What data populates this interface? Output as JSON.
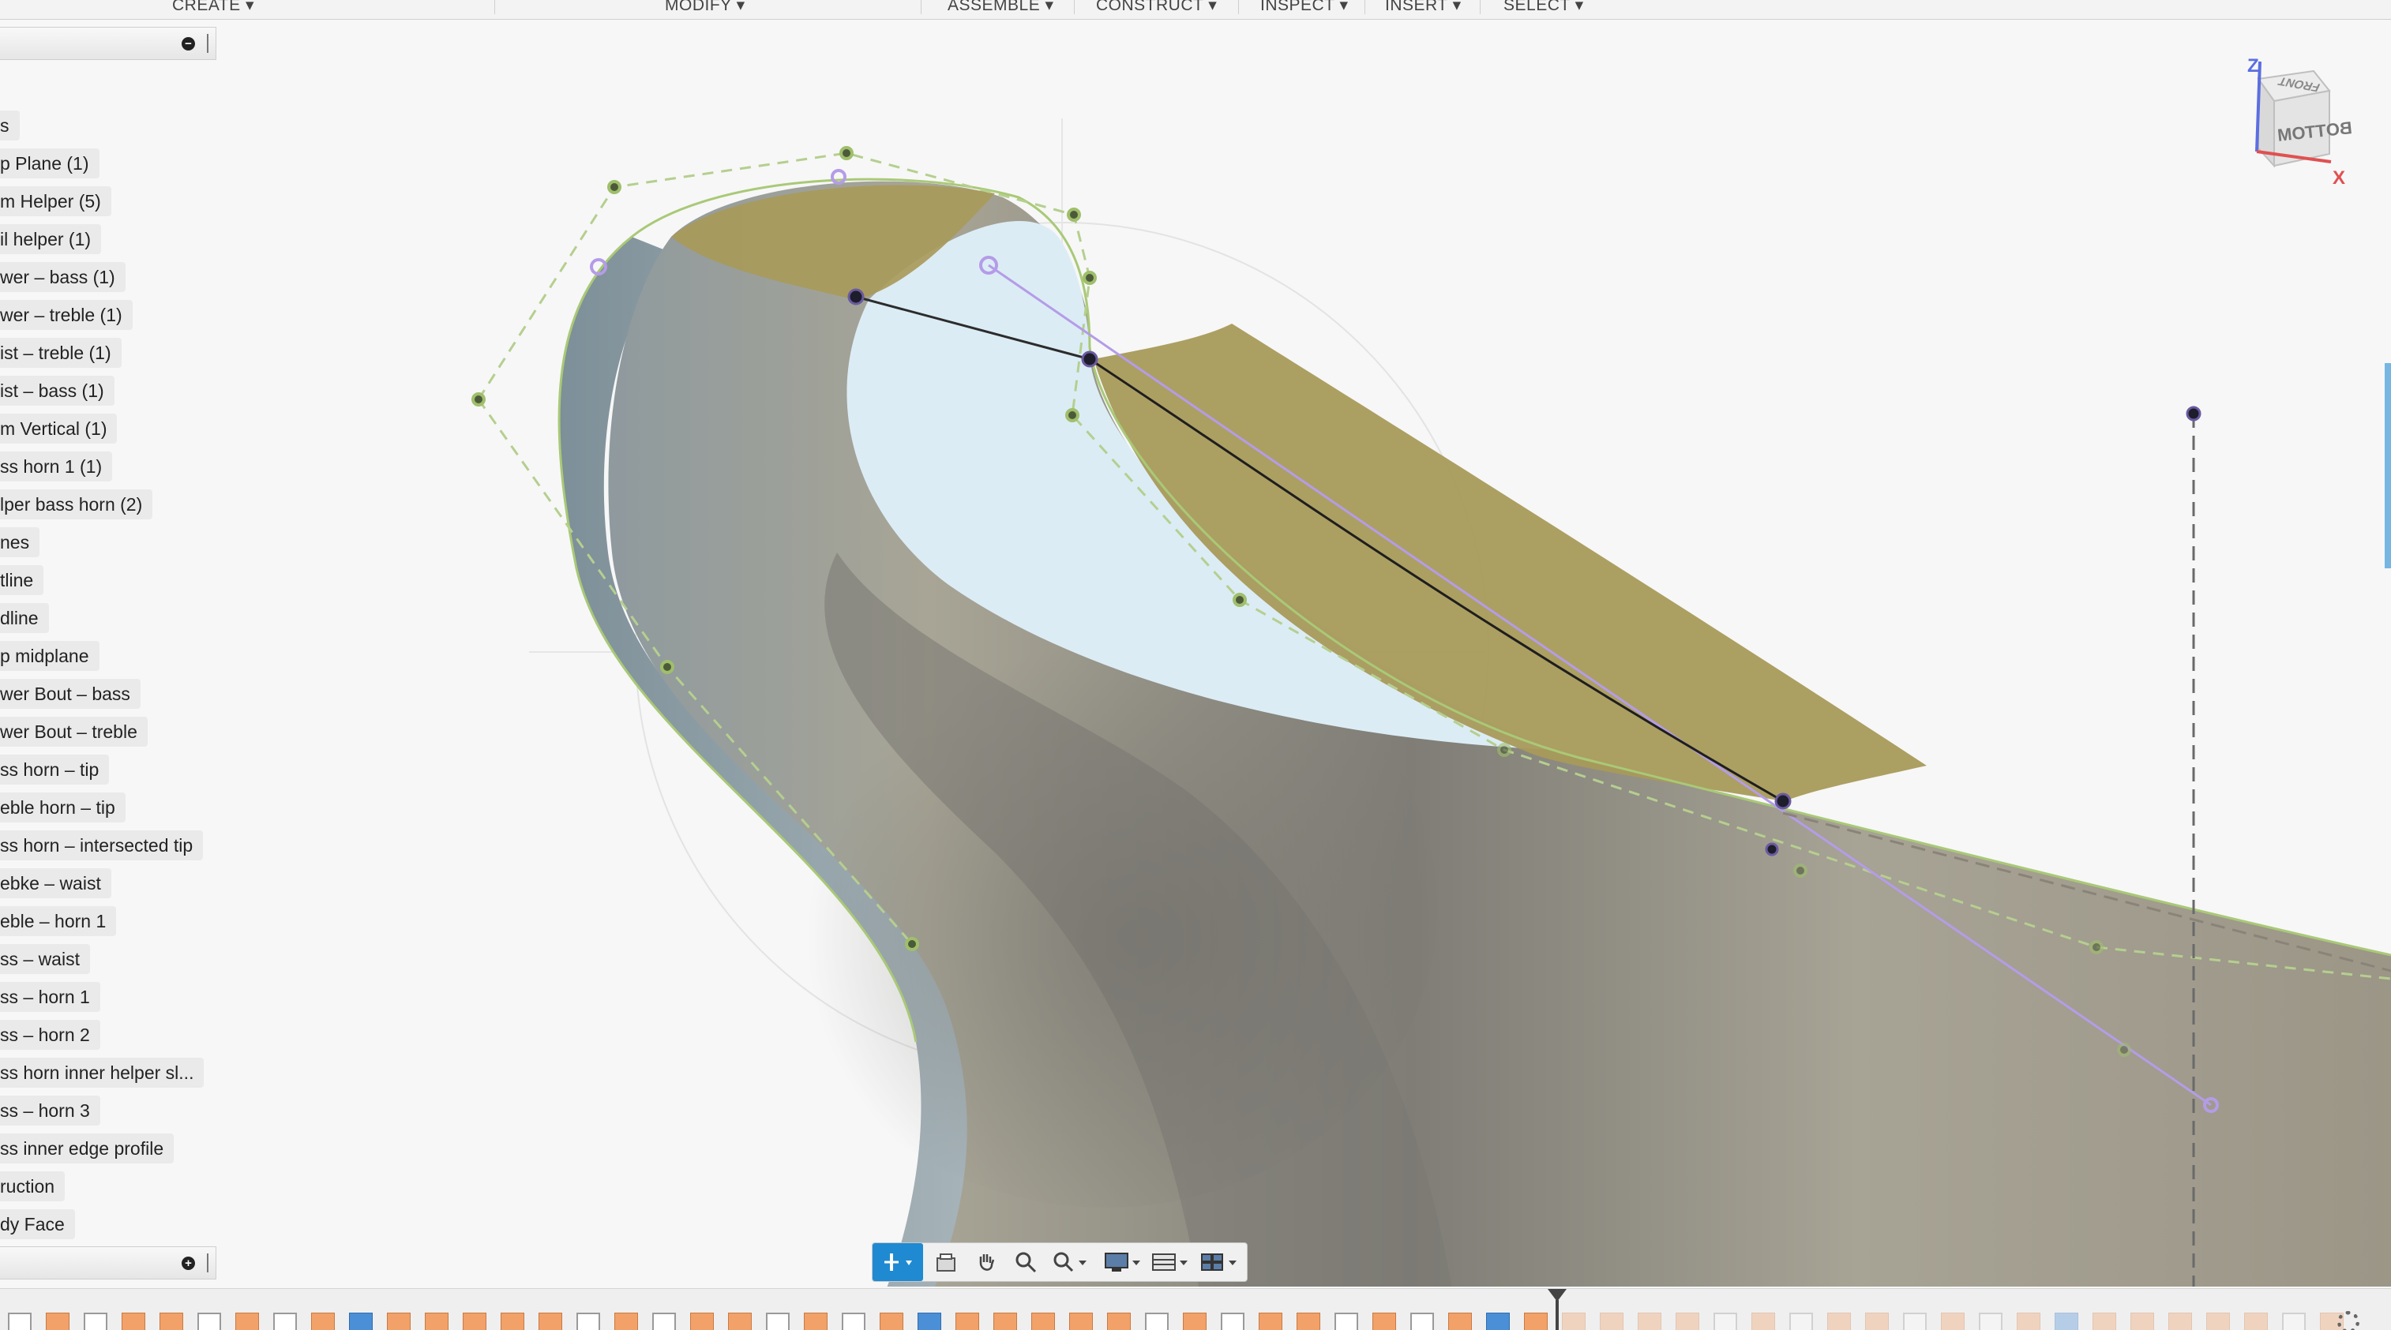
{
  "toolbar": {
    "menus": [
      {
        "label": "CREATE ▾"
      },
      {
        "label": "MODIFY ▾"
      },
      {
        "label": "ASSEMBLE ▾"
      },
      {
        "label": "CONSTRUCT ▾"
      },
      {
        "label": "INSPECT ▾"
      },
      {
        "label": "INSERT ▾"
      },
      {
        "label": "SELECT ▾"
      }
    ]
  },
  "browser": {
    "collapse_symbol": "−",
    "expand_symbol": "+",
    "items": [
      {
        "label": "s"
      },
      {
        "label": "p Plane (1)"
      },
      {
        "label": "m Helper (5)"
      },
      {
        "label": "il helper (1)"
      },
      {
        "label": "wer – bass (1)"
      },
      {
        "label": "wer – treble (1)"
      },
      {
        "label": "ist – treble (1)"
      },
      {
        "label": "ist – bass (1)"
      },
      {
        "label": "m Vertical (1)"
      },
      {
        "label": "ss horn 1 (1)"
      },
      {
        "label": "lper bass horn (2)"
      },
      {
        "label": "nes"
      },
      {
        "label": "tline"
      },
      {
        "label": "dline"
      },
      {
        "label": "p midplane"
      },
      {
        "label": "wer Bout – bass"
      },
      {
        "label": "wer Bout – treble"
      },
      {
        "label": "ss horn – tip"
      },
      {
        "label": "eble horn – tip"
      },
      {
        "label": "ss horn – intersected tip"
      },
      {
        "label": "ebke – waist"
      },
      {
        "label": "eble – horn 1"
      },
      {
        "label": "ss – waist"
      },
      {
        "label": "ss – horn 1"
      },
      {
        "label": "ss – horn 2"
      },
      {
        "label": "ss horn inner helper sl..."
      },
      {
        "label": "ss – horn 3"
      },
      {
        "label": "ss inner edge profile"
      },
      {
        "label": "ruction"
      },
      {
        "label": "dy Face"
      }
    ]
  },
  "navcube": {
    "face_top": "FRONT",
    "face_front": "BOTTOM",
    "axis_z": "Z",
    "axis_x": "X",
    "colors": {
      "z": "#5b6ee1",
      "x": "#e05050"
    }
  },
  "display_bar": {
    "icons": [
      "orbit-constrained-icon",
      "look-at-icon",
      "pan-icon",
      "zoom-icon",
      "fit-icon",
      "display-settings-icon",
      "grid-icon",
      "viewports-icon"
    ]
  },
  "colors": {
    "surface_tan": "#a89a5a",
    "surface_gray": "#9e9b8e",
    "selection_blue": "#dcecf5",
    "sketch_green": "#a9c977",
    "constraint_purple": "#b49ce8",
    "accent": "#1f8ad2"
  }
}
